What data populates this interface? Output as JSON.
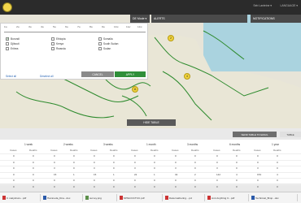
{
  "header": {
    "user": "Seb Lanteine ▾",
    "lang": "LANGUAGE ▾"
  },
  "toolbar": {
    "time_range": "DE Mode ▾",
    "alerts": "ALERTS",
    "notifications": "NOTIFICATIONS"
  },
  "filter_panel": {
    "week_ticks": [
      "1w",
      "2w",
      "3w",
      "4w",
      "5w",
      "6w",
      "7w",
      "8w",
      "9w",
      "10w",
      "11w",
      "12w"
    ],
    "options": [
      {
        "label": "Burundi",
        "checked": true
      },
      {
        "label": "Djibouti",
        "checked": false
      },
      {
        "label": "Eritrea",
        "checked": false
      },
      {
        "label": "Ethiopia",
        "checked": false
      },
      {
        "label": "Kenya",
        "checked": false
      },
      {
        "label": "Rwanda",
        "checked": false
      },
      {
        "label": "Somalia",
        "checked": false
      },
      {
        "label": "South Sudan",
        "checked": false
      },
      {
        "label": "Sudan",
        "checked": false
      }
    ],
    "select_all": "Select all",
    "deselect_all": "Deselect all",
    "cancel": "CANCEL",
    "apply": "APPLY"
  },
  "map": {
    "markers": [
      {
        "label": "2"
      },
      {
        "label": "4"
      },
      {
        "label": "11"
      }
    ]
  },
  "hide_table": "HIDE TABLE",
  "send_table": "SEND TABLE TO EMAIL",
  "table_tab": "TABLE",
  "table": {
    "periods": [
      "1 week",
      "2 weeks",
      "3 weeks",
      "1 month",
      "3 months",
      "6 months",
      "1 year"
    ],
    "subheaders": [
      "Cases",
      "Deaths"
    ],
    "rows": [
      [
        "0",
        "0",
        "0",
        "0",
        "0",
        "0",
        "0",
        "0",
        "0",
        "0",
        "0",
        "0",
        "0",
        "0"
      ],
      [
        "0",
        "0",
        "0",
        "0",
        "0",
        "0",
        "0",
        "0",
        "0",
        "0",
        "0",
        "0",
        "0",
        "0"
      ],
      [
        "0",
        "0",
        "3",
        "0",
        "3",
        "0",
        "3",
        "0",
        "3",
        "0",
        "3",
        "0",
        "3",
        "0"
      ],
      [
        "0",
        "0",
        "15",
        "1",
        "15",
        "1",
        "22",
        "1",
        "32",
        "2",
        "142",
        "4",
        "153",
        "4"
      ],
      [
        "0",
        "0",
        "0",
        "0",
        "0",
        "0",
        "0",
        "0",
        "0",
        "0",
        "0",
        "0",
        "0",
        "0"
      ],
      [
        "0",
        "0",
        "0",
        "0",
        "0",
        "0",
        "0",
        "0",
        "0",
        "0",
        "0",
        "0",
        "0",
        "0"
      ]
    ]
  },
  "taskbar": [
    {
      "label": "C malysburu...pdf",
      "type": "pdf"
    },
    {
      "label": "Hamneda_Dna...doc",
      "type": "word"
    },
    {
      "label": "survey.png",
      "type": "img"
    },
    {
      "label": "MHGCCCTCC.pdf",
      "type": "pdf"
    },
    {
      "label": "Data Gathering....pd",
      "type": "pdf"
    },
    {
      "label": "Amt Anything C...pdf",
      "type": "pdf"
    },
    {
      "label": "Technical_Brop...doc",
      "type": "word"
    }
  ]
}
